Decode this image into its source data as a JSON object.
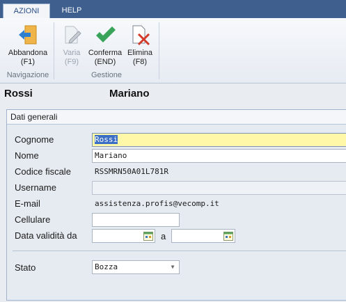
{
  "tabs": [
    {
      "label": "AZIONI",
      "active": true
    },
    {
      "label": "HELP",
      "active": false
    }
  ],
  "ribbon": {
    "groups": [
      {
        "label": "Navigazione"
      },
      {
        "label": "Gestione"
      }
    ],
    "buttons": [
      {
        "label": "Abbandona",
        "shortcut": "(F1)",
        "icon": "exit-arrow-icon",
        "enabled": true
      },
      {
        "label": "Varia",
        "shortcut": "(F9)",
        "icon": "edit-pencil-icon",
        "enabled": false
      },
      {
        "label": "Conferma",
        "shortcut": "(END)",
        "icon": "checkmark-icon",
        "enabled": true
      },
      {
        "label": "Elimina",
        "shortcut": "(F8)",
        "icon": "delete-document-icon",
        "enabled": true
      }
    ]
  },
  "person": {
    "surname": "Rossi",
    "firstname": "Mariano"
  },
  "panel": {
    "title": "Dati generali",
    "fields": {
      "cognome": {
        "label": "Cognome",
        "value": "Rossi"
      },
      "nome": {
        "label": "Nome",
        "value": "Mariano"
      },
      "codice_fiscale": {
        "label": "Codice fiscale",
        "value": "RSSMRN50A01L781R"
      },
      "username": {
        "label": "Username",
        "value": ""
      },
      "email": {
        "label": "E-mail",
        "value": "assistenza.profis@vecomp.it"
      },
      "cellulare": {
        "label": "Cellulare",
        "value": ""
      },
      "data_validita": {
        "label": "Data validità da",
        "to_label": "a",
        "from": "",
        "to": ""
      },
      "stato": {
        "label": "Stato",
        "value": "Bozza"
      }
    }
  },
  "colors": {
    "tabbar": "#3f5f8e",
    "focused_field": "#fff8a8",
    "selection": "#3b6fc5",
    "confirm_green": "#3aa35a",
    "delete_red": "#d23b2b"
  }
}
